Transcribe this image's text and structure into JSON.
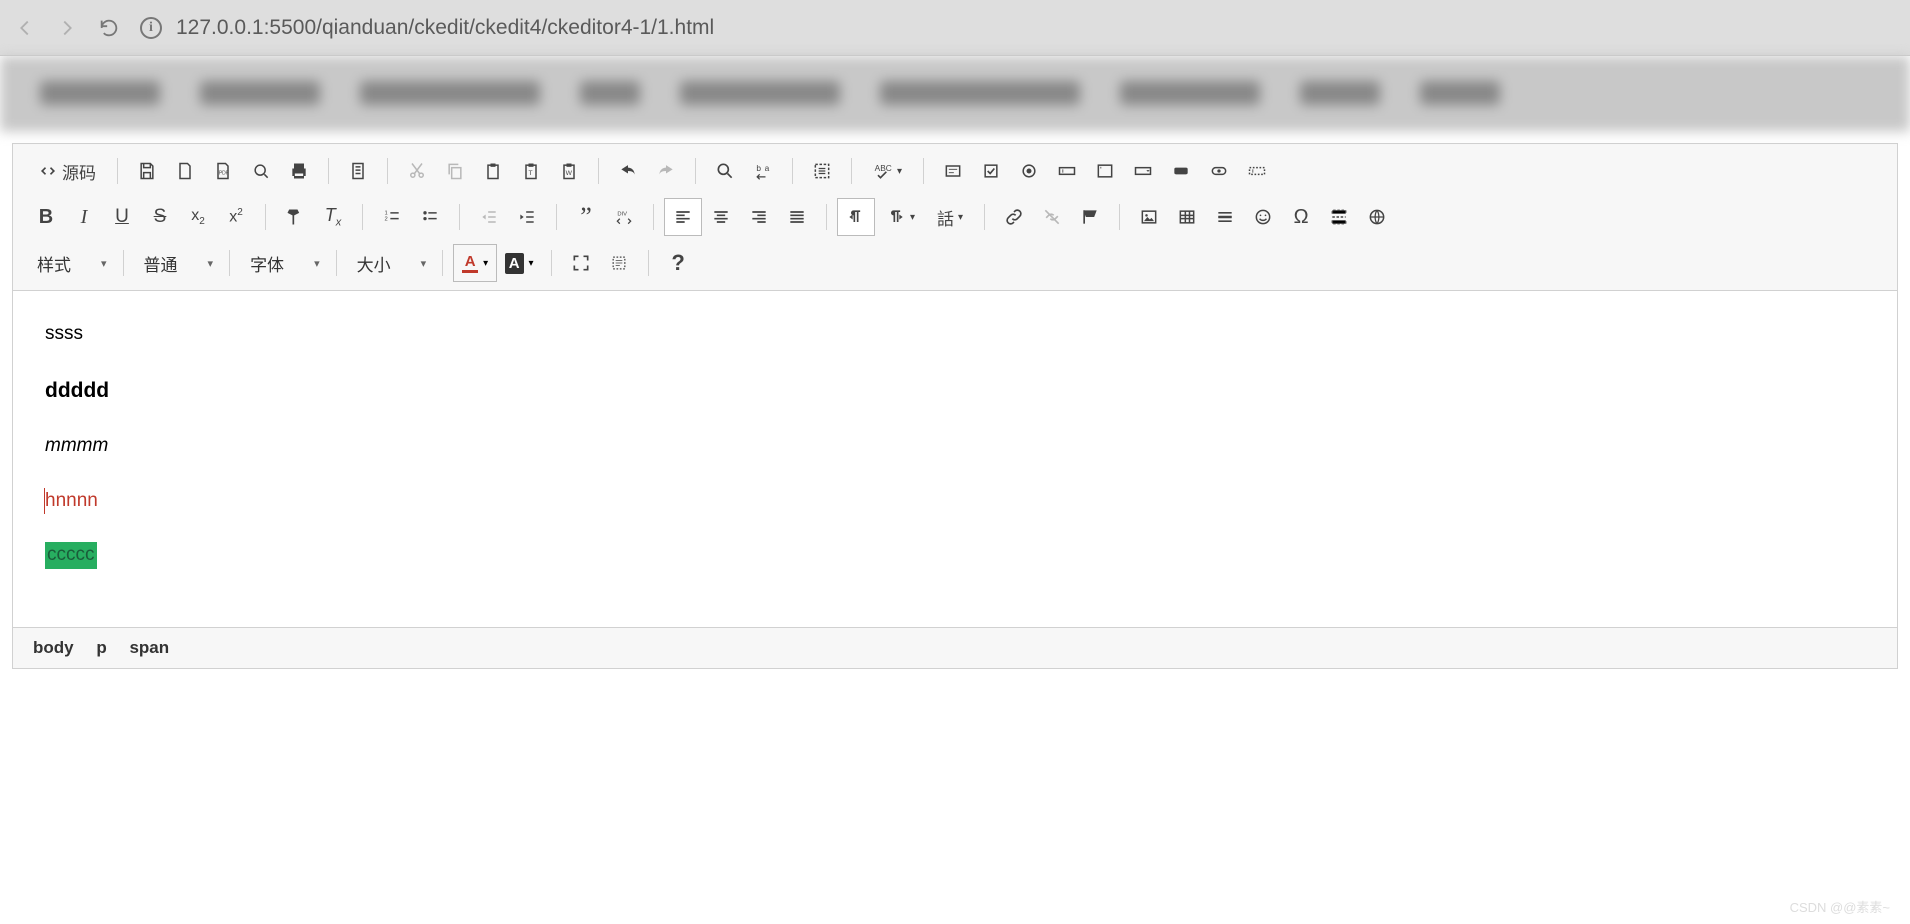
{
  "browser": {
    "url": "127.0.0.1:5500/qianduan/ckedit/ckedit4/ckeditor4-1/1.html"
  },
  "toolbar": {
    "source_label": "源码",
    "styles_label": "样式",
    "format_label": "普通",
    "font_label": "字体",
    "size_label": "大小",
    "lang_label": "話"
  },
  "content": {
    "p1": "ssss",
    "p2": "ddddd",
    "p3": "mmmm",
    "p4": "hnnnn",
    "p5": "ccccc"
  },
  "status": {
    "path": [
      "body",
      "p",
      "span"
    ]
  },
  "watermark": "CSDN @@素素~"
}
